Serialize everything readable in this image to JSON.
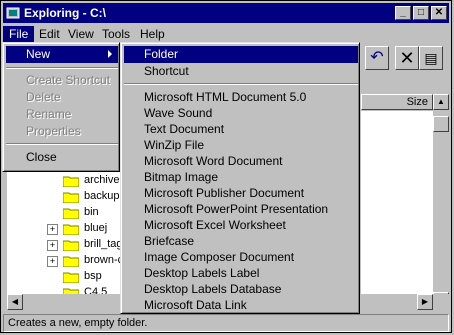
{
  "window": {
    "title": "Exploring - C:\\"
  },
  "menubar": [
    {
      "label": "File",
      "active": true
    },
    {
      "label": "Edit"
    },
    {
      "label": "View"
    },
    {
      "label": "Tools"
    },
    {
      "label": "Help"
    }
  ],
  "file_menu": {
    "new_label": "New",
    "items": [
      {
        "label": "Create Shortcut",
        "disabled": true
      },
      {
        "label": "Delete",
        "disabled": true
      },
      {
        "label": "Rename",
        "disabled": true
      },
      {
        "label": "Properties",
        "disabled": true
      },
      {
        "label": "Close",
        "disabled": false
      }
    ]
  },
  "new_submenu": {
    "items": [
      "Folder",
      "Shortcut",
      "Microsoft HTML Document 5.0",
      "Wave Sound",
      "Text Document",
      "WinZip File",
      "Microsoft Word Document",
      "Bitmap Image",
      "Microsoft Publisher Document",
      "Microsoft PowerPoint Presentation",
      "Microsoft Excel Worksheet",
      "Briefcase",
      "Image Composer Document",
      "Desktop Labels Label",
      "Desktop Labels Database",
      "Microsoft Data Link"
    ]
  },
  "tree": [
    {
      "label": "archive",
      "expandable": false
    },
    {
      "label": "backup",
      "expandable": false
    },
    {
      "label": "bin",
      "expandable": false
    },
    {
      "label": "bluej",
      "expandable": true
    },
    {
      "label": "brill_tag",
      "expandable": true
    },
    {
      "label": "brown-c",
      "expandable": true
    },
    {
      "label": "bsp",
      "expandable": false
    },
    {
      "label": "C4.5",
      "expandable": false
    }
  ],
  "list_header": {
    "size": "Size"
  },
  "status": {
    "text": "Creates a new, empty folder."
  },
  "colors": {
    "titlebar": "#000080",
    "face": "#c0c0c0",
    "highlight": "#000080"
  }
}
